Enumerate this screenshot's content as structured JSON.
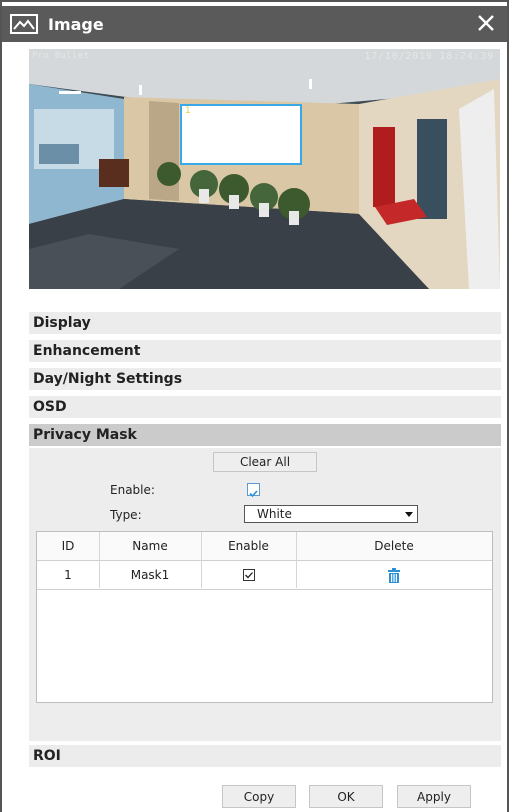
{
  "dialog": {
    "title": "Image",
    "title_icon": "image-icon",
    "close_icon": "close-icon"
  },
  "preview": {
    "osd_name": "Pro Bullet",
    "osd_time": "17/10/2019 18:24:39",
    "mask_label": "1"
  },
  "sections": [
    {
      "label": "Display"
    },
    {
      "label": "Enhancement"
    },
    {
      "label": "Day/Night Settings"
    },
    {
      "label": "OSD"
    },
    {
      "label": "Privacy Mask",
      "active": true
    },
    {
      "label": "ROI"
    }
  ],
  "privacy_mask": {
    "clear_all_label": "Clear All",
    "enable_label": "Enable:",
    "enable_checked": true,
    "type_label": "Type:",
    "type_value": "White",
    "table": {
      "columns": [
        "ID",
        "Name",
        "Enable",
        "Delete"
      ],
      "rows": [
        {
          "id": "1",
          "name": "Mask1",
          "enabled": true,
          "delete_icon": "trash-icon"
        }
      ]
    }
  },
  "footer": {
    "copy_label": "Copy",
    "ok_label": "OK",
    "apply_label": "Apply"
  },
  "colors": {
    "titlebar": "#5a5a5a",
    "accent": "#2d8fd6",
    "mask_border": "#3aa7e6"
  }
}
